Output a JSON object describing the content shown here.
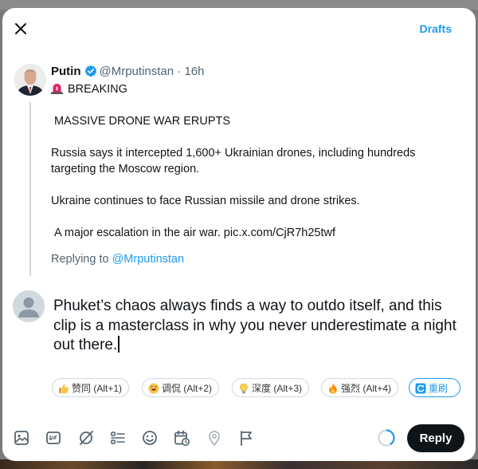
{
  "header": {
    "drafts_label": "Drafts"
  },
  "tweet": {
    "author_name": "Putin",
    "handle": "@Mrputinstan",
    "separator": "·",
    "time": "16h",
    "lines": {
      "breaking": "BREAKING",
      "headline": " MASSIVE DRONE WAR ERUPTS",
      "para1": "Russia says it intercepted 1,600+ Ukrainian drones, including hundreds targeting the Moscow region.",
      "para2": "Ukraine continues to face Russian missile and drone strikes.",
      "para3": " A major escalation in the air war. pic.x.com/CjR7h25twf"
    },
    "replying_prefix": "Replying to ",
    "replying_handle": "@Mrputinstan"
  },
  "compose": {
    "text": "Phuket’s chaos always finds a way to outdo itself, and this clip is a masterclass in why you never underestimate a night out there."
  },
  "chips": [
    {
      "label": "赞同 (Alt+1)",
      "icon": "thumbs-up-icon"
    },
    {
      "label": "调侃 (Alt+2)",
      "icon": "laughing-face-icon"
    },
    {
      "label": "深度 (Alt+3)",
      "icon": "lightbulb-icon"
    },
    {
      "label": "强烈 (Alt+4)",
      "icon": "fire-icon"
    },
    {
      "label": "重刷",
      "icon": "refresh-icon"
    }
  ],
  "toolbar": {
    "icons": [
      "image-icon",
      "gif-icon",
      "grok-icon",
      "poll-icon",
      "emoji-icon",
      "schedule-icon",
      "location-icon",
      "flag-icon"
    ],
    "reply_label": "Reply"
  },
  "colors": {
    "accent": "#1d9bf0",
    "text": "#0f1419",
    "muted": "#536471",
    "reply_button": "#0f1419"
  }
}
